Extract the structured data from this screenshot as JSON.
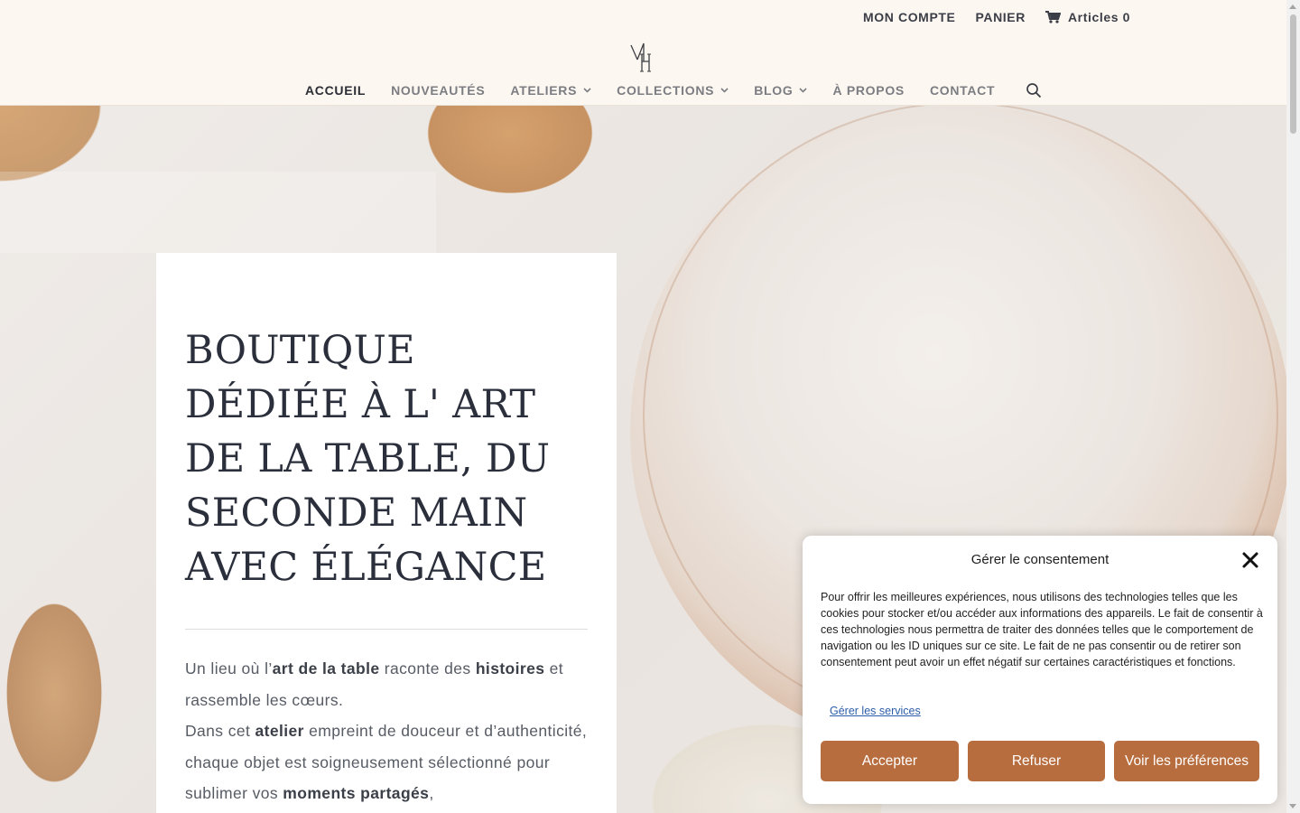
{
  "header": {
    "top_links": {
      "account": "MON COMPTE",
      "cart_page": "PANIER",
      "cart_count": "Articles 0"
    },
    "logo_icon": "monogram-logo",
    "nav": [
      {
        "label": "ACCUEIL",
        "active": true,
        "has_dropdown": false
      },
      {
        "label": "NOUVEAUTÉS",
        "active": false,
        "has_dropdown": false
      },
      {
        "label": "ATELIERS",
        "active": false,
        "has_dropdown": true
      },
      {
        "label": "COLLECTIONS",
        "active": false,
        "has_dropdown": true
      },
      {
        "label": "BLOG",
        "active": false,
        "has_dropdown": true
      },
      {
        "label": "À PROPOS",
        "active": false,
        "has_dropdown": false
      },
      {
        "label": "CONTACT",
        "active": false,
        "has_dropdown": false
      }
    ],
    "search_icon": "search-icon"
  },
  "hero": {
    "title": "BOUTIQUE DÉDIÉE À L' ART DE LA TABLE, DU SECONDE MAIN AVEC ÉLÉGANCE",
    "p1": {
      "t1": "Un lieu où l’",
      "b1": "art de la table",
      "t2": " raconte des ",
      "b2": "histoires",
      "t3": " et rassemble les cœurs."
    },
    "p2": {
      "t1": "Dans cet ",
      "b1": "atelier",
      "t2": " empreint de douceur et d’authenticité, chaque objet est soigneusement sélectionné pour sublimer vos ",
      "b2": "moments partagés",
      "t3": ","
    }
  },
  "consent": {
    "title": "Gérer le consentement",
    "text": "Pour offrir les meilleures expériences, nous utilisons des technologies telles que les cookies pour stocker et/ou accéder aux informations des appareils. Le fait de consentir à ces technologies nous permettra de traiter des données telles que le comportement de navigation ou les ID uniques sur ce site. Le fait de ne pas consentir ou de retirer son consentement peut avoir un effet négatif sur certaines caractéristiques et fonctions.",
    "manage_link": "Gérer les services",
    "accept": "Accepter",
    "refuse": "Refuser",
    "preferences": "Voir les préférences"
  },
  "colors": {
    "header_bg": "#fdf7f1",
    "button_brown": "#b86d3f",
    "title_navy": "#2a2f3b"
  }
}
